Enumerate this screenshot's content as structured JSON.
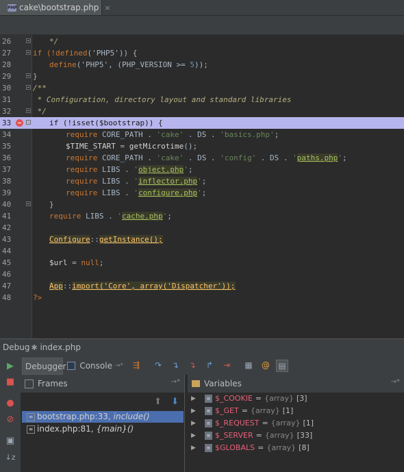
{
  "tab": {
    "title": "cake\\bootstrap.php",
    "close": "×",
    "file_icon": "php-file-icon"
  },
  "code_lines": [
    {
      "num": "26",
      "tokens": [
        {
          "t": "*/",
          "c": "cm"
        }
      ],
      "indent": 1,
      "fold": true
    },
    {
      "num": "27",
      "tokens": [
        {
          "t": "if (!",
          "c": "kw"
        },
        {
          "t": "defined",
          "c": "kw"
        },
        {
          "t": "('PHP5')) {",
          "c": "plain"
        }
      ],
      "indent": 0,
      "fold": true
    },
    {
      "num": "28",
      "tokens": [
        {
          "t": "define",
          "c": "kw"
        },
        {
          "t": "('PHP5', (PHP_VERSION >= ",
          "c": "plain"
        },
        {
          "t": "5",
          "c": "num"
        },
        {
          "t": "));",
          "c": "plain"
        }
      ],
      "indent": 1,
      "fold": false
    },
    {
      "num": "29",
      "tokens": [
        {
          "t": "}",
          "c": "plain"
        }
      ],
      "indent": 0,
      "fold": true
    },
    {
      "num": "30",
      "tokens": [
        {
          "t": "/**",
          "c": "cm"
        }
      ],
      "indent": 0,
      "fold": true
    },
    {
      "num": "31",
      "tokens": [
        {
          "t": " * Configuration, directory layout and standard libraries",
          "c": "cm"
        }
      ],
      "indent": 0,
      "fold": false
    },
    {
      "num": "32",
      "tokens": [
        {
          "t": " */",
          "c": "cm"
        }
      ],
      "indent": 0,
      "fold": true
    },
    {
      "num": "33",
      "tokens": [
        {
          "t": "if (!isset($bootstrap)) {",
          "c": "plain"
        }
      ],
      "indent": 1,
      "fold": true,
      "highlight": true,
      "breakpoint": true
    },
    {
      "num": "34",
      "tokens": [
        {
          "t": "require ",
          "c": "kw"
        },
        {
          "t": "CORE_PATH . ",
          "c": "plain"
        },
        {
          "t": "'cake'",
          "c": "str"
        },
        {
          "t": " . DS . ",
          "c": "plain"
        },
        {
          "t": "'basics.php'",
          "c": "str"
        },
        {
          "t": ";",
          "c": "plain"
        }
      ],
      "indent": 2,
      "fold": false
    },
    {
      "num": "35",
      "tokens": [
        {
          "t": "$TIME_START",
          "c": "var"
        },
        {
          "t": " = ",
          "c": "plain"
        },
        {
          "t": "getMicrotime",
          "c": "var"
        },
        {
          "t": "();",
          "c": "plain"
        }
      ],
      "indent": 2,
      "fold": false
    },
    {
      "num": "36",
      "tokens": [
        {
          "t": "require ",
          "c": "kw"
        },
        {
          "t": "CORE_PATH . ",
          "c": "plain"
        },
        {
          "t": "'cake'",
          "c": "str"
        },
        {
          "t": " . DS . ",
          "c": "plain"
        },
        {
          "t": "'config'",
          "c": "str"
        },
        {
          "t": " . DS . ",
          "c": "plain"
        },
        {
          "t": "'",
          "c": "str"
        },
        {
          "t": "paths.php",
          "c": "ulstr"
        },
        {
          "t": "'",
          "c": "str"
        },
        {
          "t": ";",
          "c": "plain"
        }
      ],
      "indent": 2,
      "fold": false
    },
    {
      "num": "37",
      "tokens": [
        {
          "t": "require ",
          "c": "kw"
        },
        {
          "t": "LIBS . ",
          "c": "plain"
        },
        {
          "t": "'",
          "c": "str"
        },
        {
          "t": "object.php",
          "c": "ulstr"
        },
        {
          "t": "'",
          "c": "str"
        },
        {
          "t": ";",
          "c": "plain"
        }
      ],
      "indent": 2,
      "fold": false
    },
    {
      "num": "38",
      "tokens": [
        {
          "t": "require ",
          "c": "kw"
        },
        {
          "t": "LIBS . ",
          "c": "plain"
        },
        {
          "t": "'",
          "c": "str"
        },
        {
          "t": "inflector.php",
          "c": "ulstr"
        },
        {
          "t": "'",
          "c": "str"
        },
        {
          "t": ";",
          "c": "plain"
        }
      ],
      "indent": 2,
      "fold": false
    },
    {
      "num": "39",
      "tokens": [
        {
          "t": "require ",
          "c": "kw"
        },
        {
          "t": "LIBS . ",
          "c": "plain"
        },
        {
          "t": "'",
          "c": "str"
        },
        {
          "t": "configure.php",
          "c": "ulstr"
        },
        {
          "t": "'",
          "c": "str"
        },
        {
          "t": ";",
          "c": "plain"
        }
      ],
      "indent": 2,
      "fold": false
    },
    {
      "num": "40",
      "tokens": [
        {
          "t": "}",
          "c": "plain"
        }
      ],
      "indent": 1,
      "fold": true
    },
    {
      "num": "41",
      "tokens": [
        {
          "t": "require ",
          "c": "kw"
        },
        {
          "t": "LIBS . ",
          "c": "plain"
        },
        {
          "t": "'",
          "c": "str"
        },
        {
          "t": "cache.php",
          "c": "ulstr"
        },
        {
          "t": "'",
          "c": "str"
        },
        {
          "t": ";",
          "c": "plain"
        }
      ],
      "indent": 1,
      "fold": false
    },
    {
      "num": "42",
      "tokens": [],
      "indent": 1,
      "fold": false
    },
    {
      "num": "43",
      "tokens": [
        {
          "t": "Configure",
          "c": "ul"
        },
        {
          "t": "::",
          "c": "plain"
        },
        {
          "t": "getInstance",
          "c": "ul"
        },
        {
          "t": "();",
          "c": "ul"
        }
      ],
      "indent": 1,
      "fold": false
    },
    {
      "num": "44",
      "tokens": [],
      "indent": 1,
      "fold": false
    },
    {
      "num": "45",
      "tokens": [
        {
          "t": "$url",
          "c": "var"
        },
        {
          "t": " = ",
          "c": "plain"
        },
        {
          "t": "null",
          "c": "kw"
        },
        {
          "t": ";",
          "c": "plain"
        }
      ],
      "indent": 1,
      "fold": false
    },
    {
      "num": "46",
      "tokens": [],
      "indent": 1,
      "fold": false
    },
    {
      "num": "47",
      "tokens": [
        {
          "t": "App",
          "c": "ul"
        },
        {
          "t": "::",
          "c": "plain"
        },
        {
          "t": "import",
          "c": "ul"
        },
        {
          "t": "('Core', array('Dispatcher'));",
          "c": "ul"
        }
      ],
      "indent": 1,
      "fold": false
    },
    {
      "num": "48",
      "tokens": [
        {
          "t": "?>",
          "c": "kw"
        }
      ],
      "indent": 0,
      "fold": false
    }
  ],
  "debug": {
    "label": "Debug",
    "bug_icon": "bug-icon",
    "file": "index.php"
  },
  "toolbar": {
    "tabs": [
      {
        "label": "Debugger",
        "icon": "debugger-icon"
      },
      {
        "label": "Console",
        "icon": "console-icon"
      }
    ],
    "icons": [
      "show-execution-point-icon",
      "step-over-icon",
      "step-into-icon",
      "force-step-into-icon",
      "step-out-icon",
      "run-to-cursor-icon",
      "evaluate-expression-icon",
      "watch-icon",
      "settings-icon"
    ]
  },
  "rail": {
    "icons": [
      "resume-icon",
      "stop-icon",
      "view-breakpoints-icon",
      "mute-breakpoints-icon",
      "layout-icon",
      "sort-icon"
    ]
  },
  "frames": {
    "title": "Frames",
    "items": [
      {
        "file": "bootstrap.php:33,",
        "ctx": "include()",
        "selected": true
      },
      {
        "file": "index.php:81,",
        "ctx": "{main}()",
        "selected": false
      }
    ]
  },
  "variables": {
    "title": "Variables",
    "items": [
      {
        "name": "$_COOKIE",
        "eq": "=",
        "type": "{array}",
        "count": "[3]"
      },
      {
        "name": "$_GET",
        "eq": "=",
        "type": "{array}",
        "count": "[1]"
      },
      {
        "name": "$_REQUEST",
        "eq": "=",
        "type": "{array}",
        "count": "[1]"
      },
      {
        "name": "$_SERVER",
        "eq": "=",
        "type": "{array}",
        "count": "[33]"
      },
      {
        "name": "$GLOBALS",
        "eq": "=",
        "type": "{array}",
        "count": "[8]"
      }
    ]
  }
}
